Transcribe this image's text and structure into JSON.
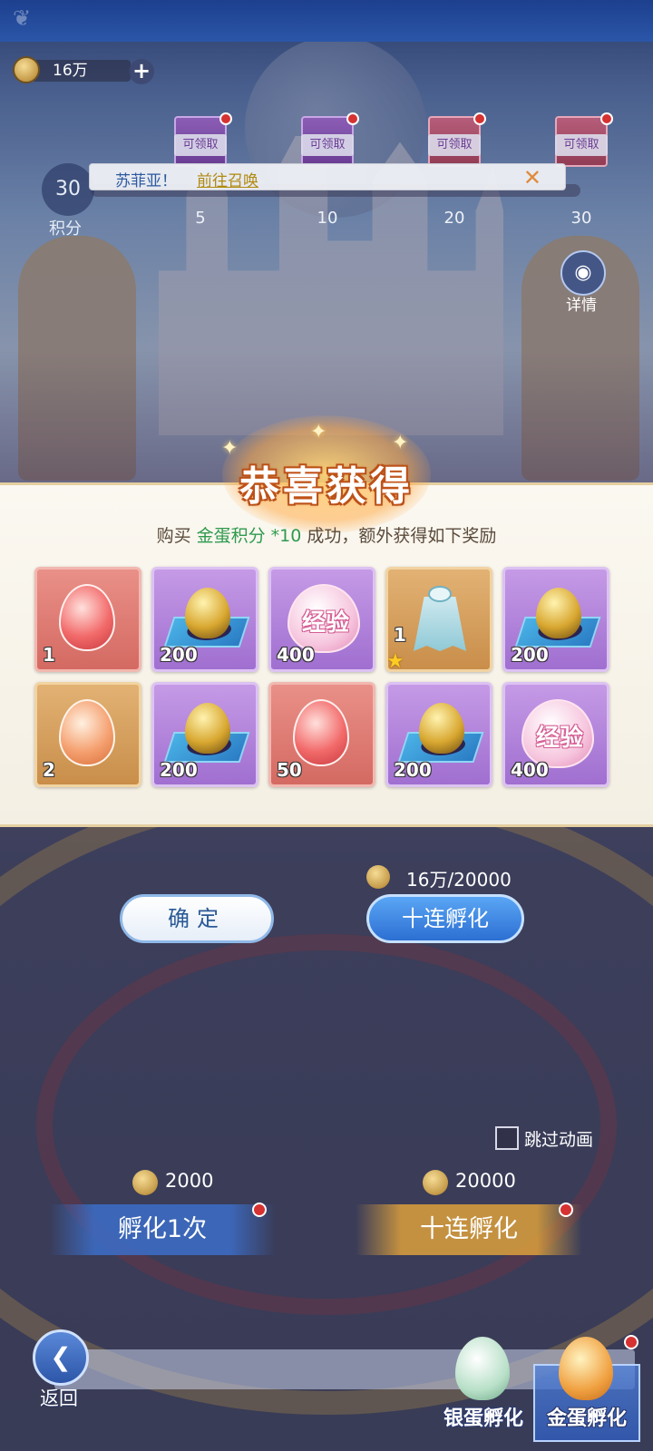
{
  "header": {
    "currency_value": "16万",
    "currency_plus": "+"
  },
  "progress": {
    "score_value": "30",
    "score_label": "积分",
    "milestones": [
      {
        "claim_label": "可领取",
        "value": "5",
        "color": "purple"
      },
      {
        "claim_label": "可领取",
        "value": "10",
        "color": "purple"
      },
      {
        "claim_label": "可领取",
        "value": "20",
        "color": "red"
      },
      {
        "claim_label": "可领取",
        "value": "30",
        "color": "red"
      }
    ]
  },
  "notice": {
    "name": "苏菲亚！",
    "link": "前往召唤",
    "close": "✕"
  },
  "detail": {
    "icon": "book-icon",
    "label": "详情"
  },
  "popup": {
    "title": "恭喜获得",
    "message_prefix": "购买 ",
    "message_highlight": "金蛋积分 *10",
    "message_suffix": " 成功，额外获得如下奖励",
    "rewards": [
      {
        "type": "red-egg",
        "count": "1",
        "rarity": "red"
      },
      {
        "type": "gold-egg-on-mat",
        "count": "200",
        "rarity": "purple"
      },
      {
        "type": "exp-egg",
        "label": "经验",
        "count": "400",
        "rarity": "purple"
      },
      {
        "type": "cape",
        "count": "1",
        "rarity": "orange",
        "star": "★"
      },
      {
        "type": "gold-egg-on-mat",
        "count": "200",
        "rarity": "purple"
      },
      {
        "type": "orange-egg",
        "count": "2",
        "rarity": "orange"
      },
      {
        "type": "gold-egg-on-mat",
        "count": "200",
        "rarity": "purple"
      },
      {
        "type": "red-egg",
        "count": "50",
        "rarity": "red"
      },
      {
        "type": "gold-egg-on-mat",
        "count": "200",
        "rarity": "purple"
      },
      {
        "type": "exp-egg",
        "label": "经验",
        "count": "400",
        "rarity": "purple"
      }
    ],
    "confirm_label": "确定",
    "ten_label": "十连孵化",
    "ten_cost": "16万/20000"
  },
  "controls": {
    "skip_label": "跳过动画",
    "single_cost": "2000",
    "single_label": "孵化1次",
    "ten_cost": "20000",
    "ten_label": "十连孵化"
  },
  "bottom": {
    "back_label": "返回",
    "tab_silver": "银蛋孵化",
    "tab_gold": "金蛋孵化"
  }
}
